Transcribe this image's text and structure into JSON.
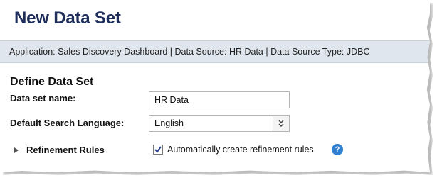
{
  "page": {
    "title": "New Data Set"
  },
  "info_bar": {
    "text": "Application: Sales Discovery Dashboard | Data Source: HR Data | Data Source Type: JDBC"
  },
  "form": {
    "section_title": "Define Data Set",
    "name_label": "Data set name:",
    "name_value": "HR Data",
    "language_label": "Default Search Language:",
    "language_value": "English",
    "refinement_label": "Refinement Rules",
    "auto_refine_checked": true,
    "auto_refine_label": "Automatically create refinement rules",
    "help_glyph": "?"
  },
  "icons": {
    "expand": "triangle-right-icon",
    "select_arrow": "double-chevron-down-icon",
    "checkbox_check": "checkmark-icon",
    "help": "question-circle-icon"
  },
  "colors": {
    "title": "#1f2d5a",
    "info_bar_bg": "#dfe6ee",
    "help_icon": "#2f7fd3"
  }
}
